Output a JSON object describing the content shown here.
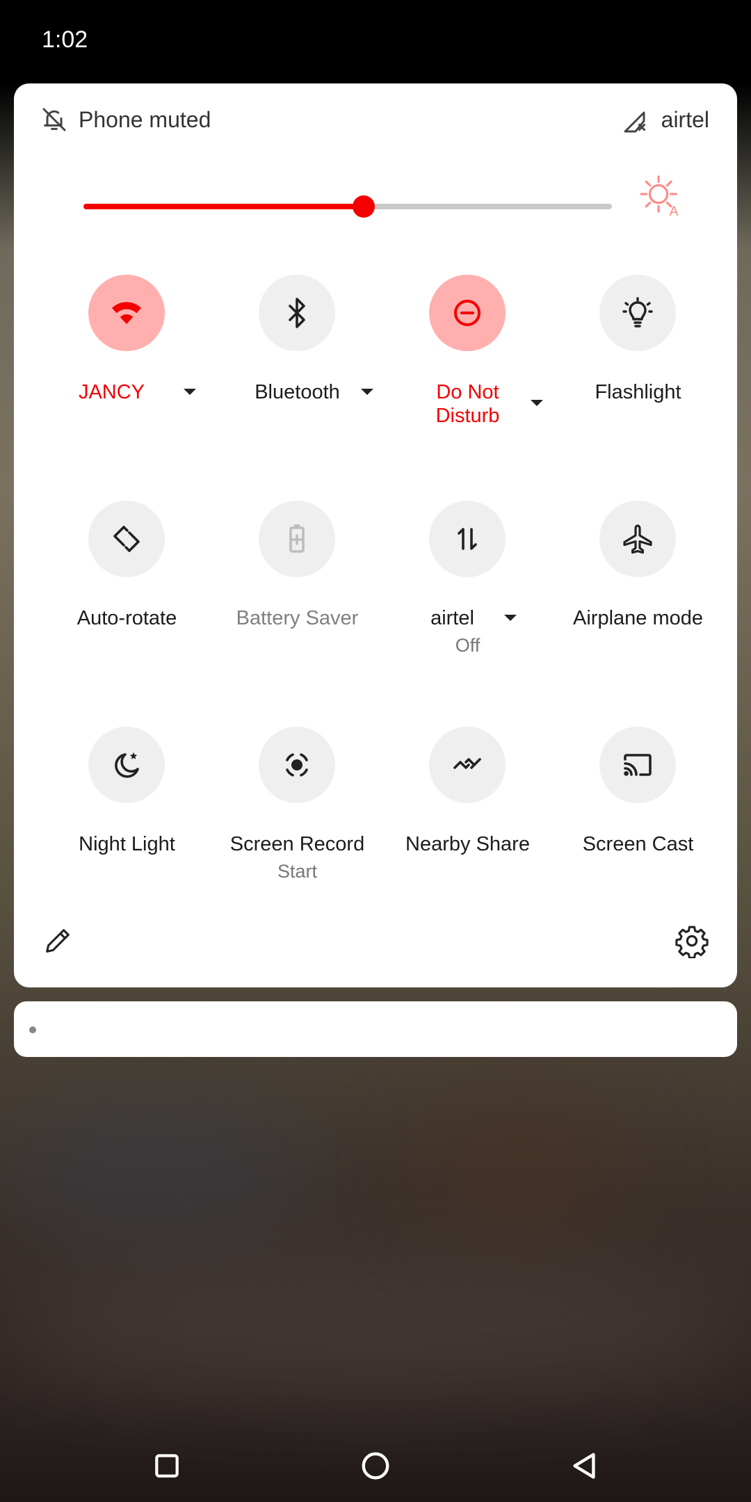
{
  "status_bar": {
    "time": "1:02"
  },
  "quick_settings": {
    "header": {
      "ringer_status": "Phone muted",
      "carrier": "airtel"
    },
    "brightness": {
      "level": 0.53
    },
    "tiles": [
      {
        "label": "JANCY",
        "sub": "",
        "icon": "wifi-icon",
        "state": "on"
      },
      {
        "label": "Bluetooth",
        "sub": "",
        "icon": "bluetooth-icon",
        "state": "off"
      },
      {
        "label": "Do Not\nDisturb",
        "sub": "",
        "icon": "do-not-disturb-icon",
        "state": "on"
      },
      {
        "label": "Flashlight",
        "sub": "",
        "icon": "flashlight-icon",
        "state": "off"
      },
      {
        "label": "Auto-rotate",
        "sub": "",
        "icon": "auto-rotate-icon",
        "state": "off"
      },
      {
        "label": "Battery Saver",
        "sub": "",
        "icon": "battery-saver-icon",
        "state": "unavailable"
      },
      {
        "label": "airtel",
        "sub": "Off",
        "icon": "mobile-data-icon",
        "state": "off"
      },
      {
        "label": "Airplane mode",
        "sub": "",
        "icon": "airplane-icon",
        "state": "off"
      },
      {
        "label": "Night Light",
        "sub": "",
        "icon": "night-light-icon",
        "state": "off"
      },
      {
        "label": "Screen Record",
        "sub": "Start",
        "icon": "screen-record-icon",
        "state": "off"
      },
      {
        "label": "Nearby Share",
        "sub": "",
        "icon": "nearby-share-icon",
        "state": "off"
      },
      {
        "label": "Screen Cast",
        "sub": "",
        "icon": "screen-cast-icon",
        "state": "off"
      }
    ],
    "footer": {
      "edit_icon": "pencil-icon",
      "settings_icon": "gear-icon"
    }
  },
  "colors": {
    "accent": "#f50000",
    "tile_active_bg": "#ffb0ae",
    "tile_inactive_bg": "#efefef"
  },
  "nav_bar": {
    "buttons": [
      "recents-icon",
      "home-icon",
      "back-icon"
    ]
  }
}
